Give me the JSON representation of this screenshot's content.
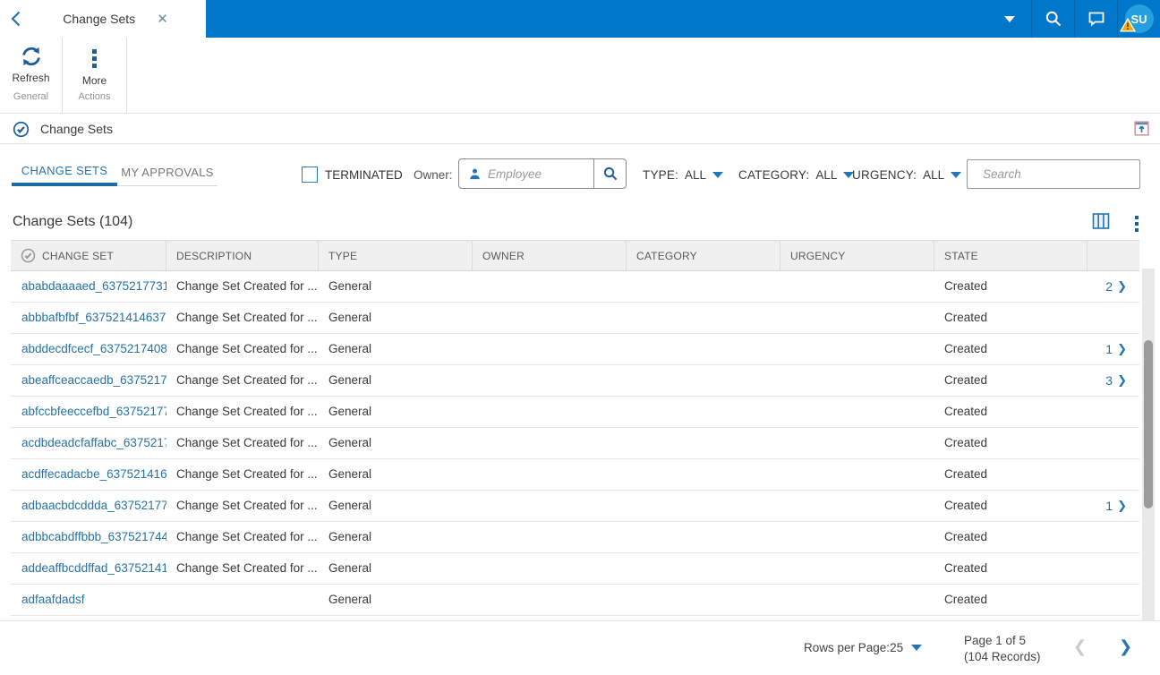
{
  "colors": {
    "topbar_blue": "#0077c8",
    "accent_blue": "#2276b5",
    "icon_blue": "#1d5f9e",
    "link_blue": "#2573a7",
    "avatar_blue": "#259fe0",
    "warning_yellow": "#f5a800"
  },
  "topbar": {
    "tab_title": "Change Sets",
    "avatar_initials": "SU"
  },
  "toolbar": {
    "refresh_label": "Refresh",
    "more_label": "More",
    "group_general": "General",
    "group_actions": "Actions"
  },
  "section": {
    "title": "Change Sets"
  },
  "tabs": {
    "change_sets": "CHANGE SETS",
    "my_approvals": "MY APPROVALS"
  },
  "filters": {
    "terminated_label": "TERMINATED",
    "owner_label": "Owner:",
    "owner_placeholder": "Employee",
    "type_label": "TYPE:",
    "type_value": "ALL",
    "category_label": "CATEGORY:",
    "category_value": "ALL",
    "urgency_label": "URGENCY:",
    "urgency_value": "ALL",
    "search_placeholder": "Search"
  },
  "list": {
    "title": "Change Sets (104)"
  },
  "table": {
    "columns": [
      "CHANGE SET",
      "DESCRIPTION",
      "TYPE",
      "OWNER",
      "CATEGORY",
      "URGENCY",
      "STATE"
    ],
    "rows": [
      {
        "id": "ababdaaaaed_6375217731",
        "description": "Change Set Created for ...",
        "type": "General",
        "owner": "",
        "category": "",
        "urgency": "",
        "state": "Created",
        "drill": "2"
      },
      {
        "id": "abbbafbfbf_637521414637",
        "description": "Change Set Created for ...",
        "type": "General",
        "owner": "",
        "category": "",
        "urgency": "",
        "state": "Created",
        "drill": ""
      },
      {
        "id": "abddecdfcecf_6375217408",
        "description": "Change Set Created for ...",
        "type": "General",
        "owner": "",
        "category": "",
        "urgency": "",
        "state": "Created",
        "drill": "1"
      },
      {
        "id": "abeaffceaccaedb_6375217",
        "description": "Change Set Created for ...",
        "type": "General",
        "owner": "",
        "category": "",
        "urgency": "",
        "state": "Created",
        "drill": "3"
      },
      {
        "id": "abfccbfeeccefbd_63752177",
        "description": "Change Set Created for ...",
        "type": "General",
        "owner": "",
        "category": "",
        "urgency": "",
        "state": "Created",
        "drill": ""
      },
      {
        "id": "acdbdeadcfaffabc_6375217",
        "description": "Change Set Created for ...",
        "type": "General",
        "owner": "",
        "category": "",
        "urgency": "",
        "state": "Created",
        "drill": ""
      },
      {
        "id": "acdffecadacbe_637521416",
        "description": "Change Set Created for ...",
        "type": "General",
        "owner": "",
        "category": "",
        "urgency": "",
        "state": "Created",
        "drill": ""
      },
      {
        "id": "adbaacbdcddda_63752177",
        "description": "Change Set Created for ...",
        "type": "General",
        "owner": "",
        "category": "",
        "urgency": "",
        "state": "Created",
        "drill": "1"
      },
      {
        "id": "adbbcabdffbbb_637521744",
        "description": "Change Set Created for ...",
        "type": "General",
        "owner": "",
        "category": "",
        "urgency": "",
        "state": "Created",
        "drill": ""
      },
      {
        "id": "addeaffbcddffad_63752141",
        "description": "Change Set Created for ...",
        "type": "General",
        "owner": "",
        "category": "",
        "urgency": "",
        "state": "Created",
        "drill": ""
      },
      {
        "id": "adfaafdadsf",
        "description": "",
        "type": "General",
        "owner": "",
        "category": "",
        "urgency": "",
        "state": "Created",
        "drill": ""
      }
    ]
  },
  "footer": {
    "rows_per_page_label": "Rows per Page:",
    "rows_per_page_value": "25",
    "page_text": "Page 1 of 5",
    "records_text": "(104 Records)"
  }
}
